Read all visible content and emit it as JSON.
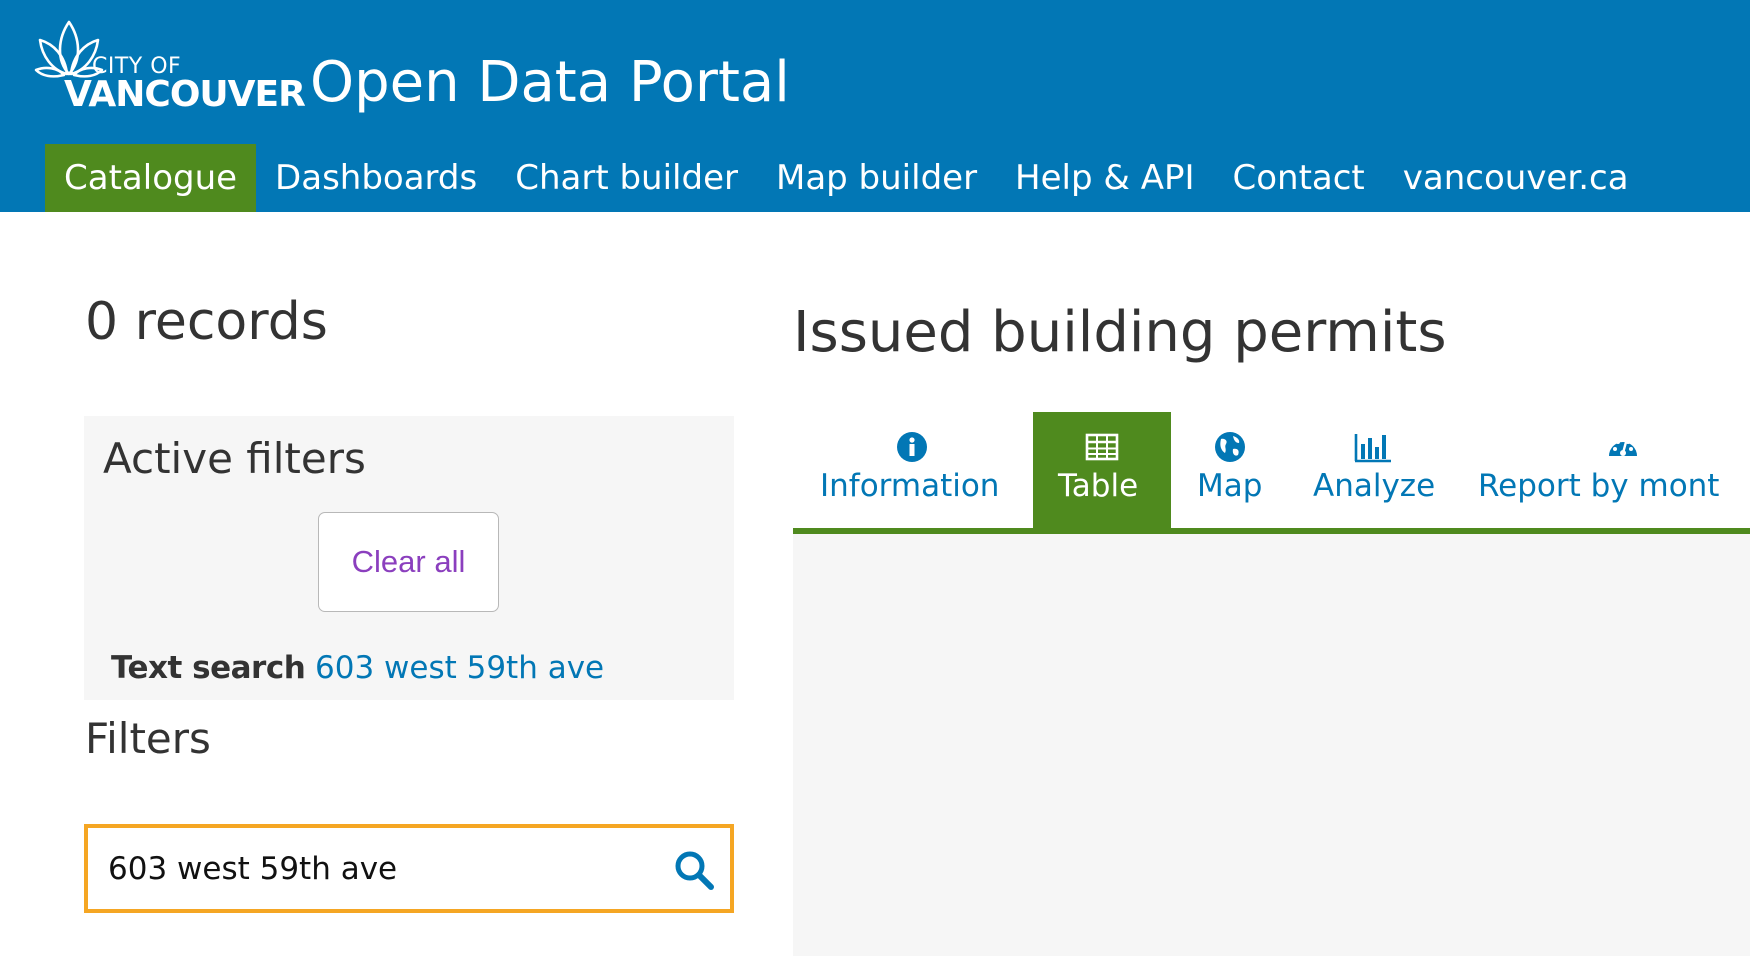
{
  "header": {
    "logo_line1": "CITY OF",
    "logo_line2": "VANCOUVER",
    "portal_title": "Open Data Portal",
    "background_color": "#0277b5",
    "nav": [
      {
        "label": "Catalogue",
        "active": true
      },
      {
        "label": "Dashboards",
        "active": false
      },
      {
        "label": "Chart builder",
        "active": false
      },
      {
        "label": "Map builder",
        "active": false
      },
      {
        "label": "Help & API",
        "active": false
      },
      {
        "label": "Contact",
        "active": false
      },
      {
        "label": "vancouver.ca",
        "active": false
      }
    ],
    "active_color": "#4f8a1e"
  },
  "sidebar": {
    "records_count": "0 records",
    "active_filters": {
      "title": "Active filters",
      "clear_all_label": "Clear all",
      "text_search_label": "Text search",
      "text_search_value": "603 west 59th ave"
    },
    "filters_title": "Filters",
    "search": {
      "value": "603 west 59th ave",
      "icon": "search-icon",
      "focus_color": "#f5a623"
    }
  },
  "main": {
    "dataset_title": "Issued building permits",
    "tabs": [
      {
        "label": "Information",
        "icon": "info-icon",
        "active": false
      },
      {
        "label": "Table",
        "icon": "table-icon",
        "active": true
      },
      {
        "label": "Map",
        "icon": "globe-icon",
        "active": false
      },
      {
        "label": "Analyze",
        "icon": "bar-chart-icon",
        "active": false
      },
      {
        "label": "Report by mont",
        "icon": "dashboard-gauge-icon",
        "active": false
      }
    ]
  }
}
